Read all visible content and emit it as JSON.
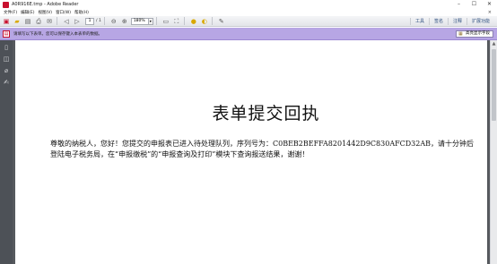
{
  "window": {
    "title": "A0R916E.tmp - Adobe Reader",
    "controls": [
      "–",
      "☐",
      "✕"
    ]
  },
  "menubar": {
    "items": [
      "文件(F)",
      "编辑(E)",
      "视图(V)",
      "窗口(W)",
      "帮助(H)"
    ],
    "close_doc": "×"
  },
  "toolbar": {
    "page_number": "1",
    "page_total": "/ 1",
    "zoom": "180%",
    "right_tools": [
      "工具",
      "签名",
      "注释",
      "扩展功能"
    ]
  },
  "message_bar": {
    "text": "请填写以下表单。您可以保存键入本表单的数据。",
    "highlight_button": "高亮显示字段"
  },
  "document": {
    "title": "表单提交回执",
    "body": "尊敬的纳税人，您好！您提交的申报表已进入待处理队列，序列号为：C0BEB2BEFFA8201442D9C830AFCD32AB，请十分钟后登陆电子税务局，在“申报缴税”的“申报查询及打印”模块下查询报送结果，谢谢！"
  },
  "colors": {
    "message_bar": "#b7a6e4",
    "nav_pane": "#4d5157",
    "brand_red": "#c8102e"
  },
  "icons": {
    "toolbar": [
      "create-pdf-icon",
      "open-icon",
      "save-icon",
      "print-icon",
      "email-icon",
      "prev-page-icon",
      "next-page-icon",
      "zoom-out-icon",
      "zoom-in-icon",
      "fit-page-icon",
      "full-screen-icon",
      "comment-icon",
      "highlight-icon",
      "sign-icon"
    ],
    "nav": [
      "pages-icon",
      "layers-icon",
      "attachments-icon",
      "signatures-icon"
    ]
  }
}
